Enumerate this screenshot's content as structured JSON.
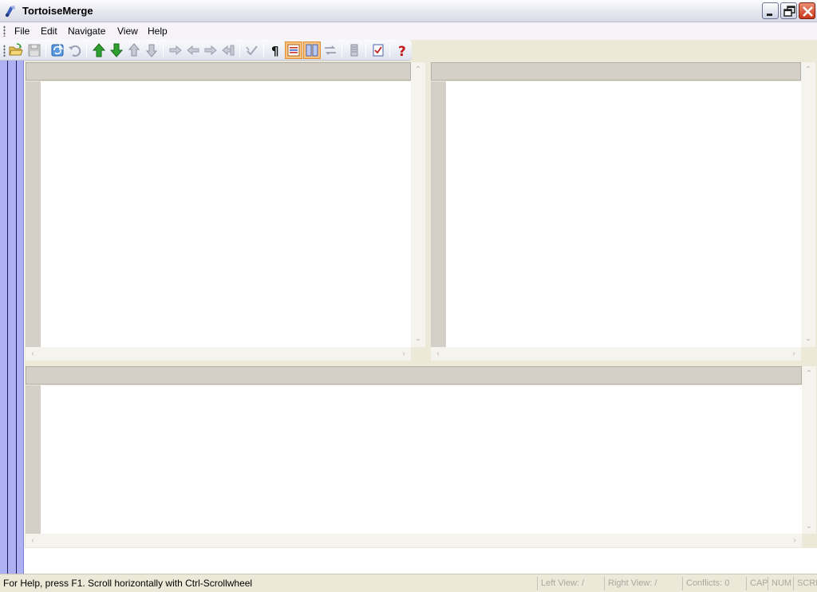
{
  "window": {
    "title": "TortoiseMerge",
    "icon": "tortoise-app-icon",
    "controls": [
      "minimize-icon",
      "restore-icon",
      "close-icon"
    ]
  },
  "menu": {
    "items": [
      "File",
      "Edit",
      "Navigate",
      "View",
      "Help"
    ]
  },
  "toolbar": {
    "buttons": [
      {
        "icon": "open-folder-icon",
        "enabled": true
      },
      {
        "icon": "save-icon",
        "enabled": false
      },
      {
        "icon": "reload-icon",
        "enabled": true
      },
      {
        "icon": "undo-icon",
        "enabled": false
      },
      {
        "icon": "previous-difference-icon",
        "enabled": true
      },
      {
        "icon": "next-difference-icon",
        "enabled": true
      },
      {
        "icon": "previous-conflict-icon",
        "enabled": false
      },
      {
        "icon": "next-conflict-icon",
        "enabled": false
      },
      {
        "icon": "use-theirs-icon",
        "enabled": false
      },
      {
        "icon": "use-mine-icon",
        "enabled": false
      },
      {
        "icon": "use-theirs-before-mine-icon",
        "enabled": false
      },
      {
        "icon": "use-mine-before-theirs-icon",
        "enabled": false
      },
      {
        "icon": "mark-resolved-icon",
        "enabled": false
      },
      {
        "icon": "whitespace-pilcrow-icon",
        "enabled": true
      },
      {
        "icon": "one-pane-view-icon",
        "enabled": true,
        "checked": true
      },
      {
        "icon": "two-pane-view-icon",
        "enabled": true,
        "checked": true
      },
      {
        "icon": "switch-left-right-icon",
        "enabled": false
      },
      {
        "icon": "locator-bar-icon",
        "enabled": false
      },
      {
        "icon": "create-patch-icon",
        "enabled": true
      },
      {
        "icon": "help-icon",
        "enabled": true
      }
    ]
  },
  "colors": {
    "locator_strip": "#aeb0f4",
    "header": "#d4d0c8",
    "editor": "#ffffff",
    "checked_button": "#f7c383"
  },
  "statusbar": {
    "help_text": "For Help, press F1. Scroll horizontally with Ctrl-Scrollwheel",
    "left_view": "Left View: /",
    "right_view": "Right View: /",
    "conflicts": "Conflicts: 0",
    "cap": "CAP",
    "num": "NUM",
    "scrl": "SCRL"
  }
}
